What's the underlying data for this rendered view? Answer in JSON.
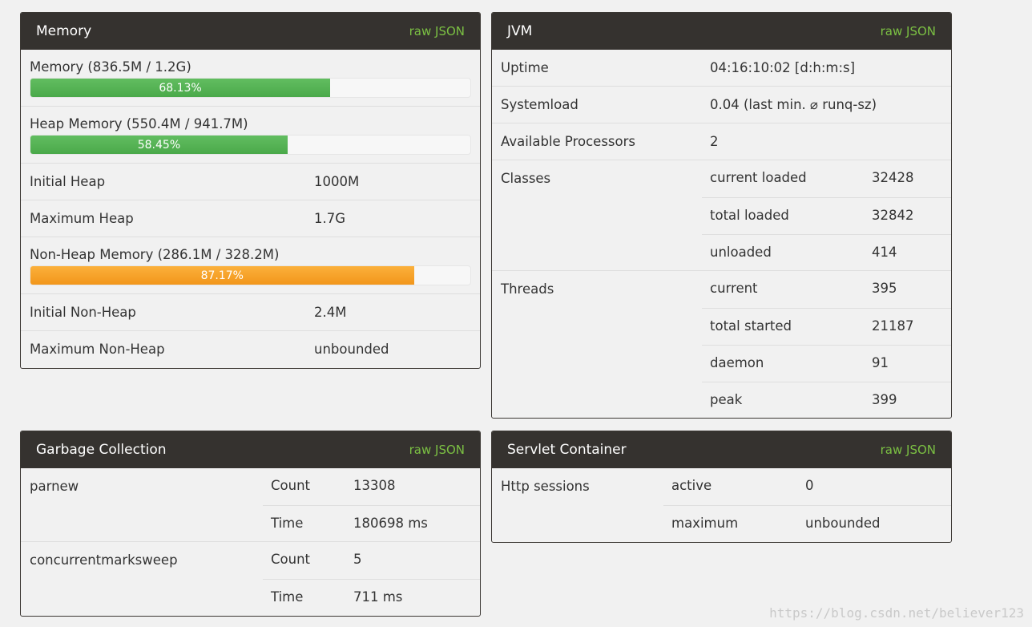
{
  "memory": {
    "title": "Memory",
    "raw_json": "raw JSON",
    "memory_label": "Memory (836.5M / 1.2G)",
    "memory_pct": "68.13%",
    "memory_fraction": 0.6813,
    "heap_label": "Heap Memory (550.4M / 941.7M)",
    "heap_pct": "58.45%",
    "heap_fraction": 0.5845,
    "initial_heap_label": "Initial Heap",
    "initial_heap_value": "1000M",
    "max_heap_label": "Maximum Heap",
    "max_heap_value": "1.7G",
    "nonheap_label": "Non-Heap Memory (286.1M / 328.2M)",
    "nonheap_pct": "87.17%",
    "nonheap_fraction": 0.8717,
    "initial_nonheap_label": "Initial Non-Heap",
    "initial_nonheap_value": "2.4M",
    "max_nonheap_label": "Maximum Non-Heap",
    "max_nonheap_value": "unbounded"
  },
  "jvm": {
    "title": "JVM",
    "raw_json": "raw JSON",
    "uptime_label": "Uptime",
    "uptime_value": "04:16:10:02 [d:h:m:s]",
    "systemload_label": "Systemload",
    "systemload_value": "0.04 (last min. ⌀ runq-sz)",
    "processors_label": "Available Processors",
    "processors_value": "2",
    "classes_label": "Classes",
    "classes": [
      {
        "label": "current loaded",
        "value": "32428"
      },
      {
        "label": "total loaded",
        "value": "32842"
      },
      {
        "label": "unloaded",
        "value": "414"
      }
    ],
    "threads_label": "Threads",
    "threads": [
      {
        "label": "current",
        "value": "395"
      },
      {
        "label": "total started",
        "value": "21187"
      },
      {
        "label": "daemon",
        "value": "91"
      },
      {
        "label": "peak",
        "value": "399"
      }
    ]
  },
  "gc": {
    "title": "Garbage Collection",
    "raw_json": "raw JSON",
    "collectors": [
      {
        "name": "parnew",
        "count_label": "Count",
        "count": "13308",
        "time_label": "Time",
        "time": "180698 ms"
      },
      {
        "name": "concurrentmarksweep",
        "count_label": "Count",
        "count": "5",
        "time_label": "Time",
        "time": "711 ms"
      }
    ]
  },
  "servlet": {
    "title": "Servlet Container",
    "raw_json": "raw JSON",
    "sessions_label": "Http sessions",
    "active_label": "active",
    "active_value": "0",
    "maximum_label": "maximum",
    "maximum_value": "unbounded"
  },
  "watermark": "https://blog.csdn.net/believer123",
  "colors": {
    "header_bg": "#35322f",
    "link_green": "#7bc043",
    "bar_green": "#5cb85c",
    "bar_orange": "#f7a12b"
  }
}
